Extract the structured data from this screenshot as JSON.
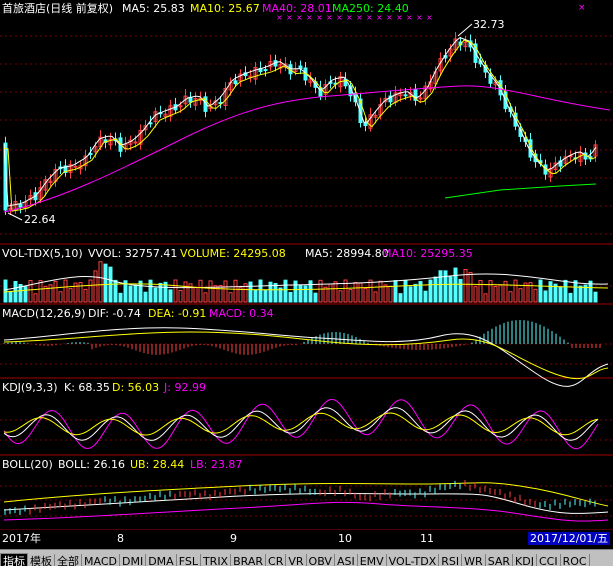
{
  "colors": {
    "up": "#ff4040",
    "down": "#54ffff",
    "ma5": "#ffffff",
    "ma10": "#ffff00",
    "ma40": "#ff00ff",
    "ma250": "#00ff00",
    "grid": "#7a0000"
  },
  "main": {
    "title": "首旅酒店(日线 前复权)",
    "ma5": "MA5: 25.83",
    "ma10": "MA10: 25.67",
    "ma40": "MA40: 28.01",
    "ma250": "MA250: 24.40",
    "high_label": "32.73",
    "low_label": "22.64"
  },
  "vol": {
    "name": "VOL-TDX(5,10)",
    "vvol": "VVOL: 32757.41",
    "volume": "VOLUME: 24295.08",
    "ma5": "MA5: 28994.80",
    "ma10": "MA10: 25295.35"
  },
  "macd": {
    "name": "MACD(12,26,9)",
    "dif": "DIF: -0.74",
    "dea": "DEA: -0.91",
    "macd": "MACD: 0.34"
  },
  "kdj": {
    "name": "KDJ(9,3,3)",
    "k": "K: 68.35",
    "d": "D: 56.03",
    "j": "J: 92.99"
  },
  "boll": {
    "name": "BOLL(20)",
    "boll": "BOLL: 26.16",
    "ub": "UB: 28.44",
    "lb": "LB: 23.87"
  },
  "axis": {
    "year": "2017年",
    "m8": "8",
    "m9": "9",
    "m10": "10",
    "m11": "11",
    "date_box": "2017/12/01/五"
  },
  "tabs": [
    "指标",
    "模板",
    "全部",
    "MACD",
    "DMI",
    "DMA",
    "FSL",
    "TRIX",
    "BRAR",
    "CR",
    "VR",
    "OBV",
    "ASI",
    "EMV",
    "VOL-TDX",
    "RSI",
    "WR",
    "SAR",
    "KDJ",
    "CCI",
    "ROC"
  ]
}
